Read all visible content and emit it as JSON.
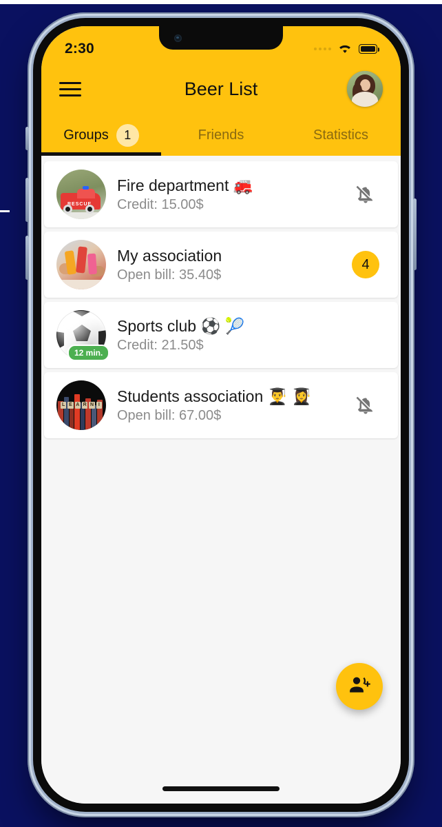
{
  "theme": {
    "accent": "#ffc20e",
    "badge_soft": "#ffe7a6",
    "page_bg": "#0a1160",
    "list_bg": "#f6f6f6",
    "card_bg": "#ffffff",
    "muted_text": "#8b8b8b",
    "green_badge": "#4caf50"
  },
  "status_bar": {
    "time": "2:30",
    "signal_icon": "signal-dots-icon",
    "wifi_icon": "wifi-icon",
    "battery_icon": "battery-full-icon"
  },
  "app_bar": {
    "menu_icon": "hamburger-menu-icon",
    "title": "Beer List",
    "avatar_icon": "user-avatar-photo"
  },
  "tabs": [
    {
      "label": "Groups",
      "badge": "1",
      "active": true
    },
    {
      "label": "Friends",
      "badge": "",
      "active": false
    },
    {
      "label": "Statistics",
      "badge": "",
      "active": false
    }
  ],
  "groups": [
    {
      "title": "Fire department 🚒",
      "subtitle": "Credit: 15.00$",
      "right_icon": "bell-off-icon",
      "right_badge": "",
      "thumb_badge": "",
      "thumb_icon": "fire-truck-thumbnail"
    },
    {
      "title": "My association",
      "subtitle": "Open bill: 35.40$",
      "right_icon": "",
      "right_badge": "4",
      "thumb_badge": "",
      "thumb_icon": "cheers-drinks-thumbnail"
    },
    {
      "title": "Sports club ⚽ 🎾",
      "subtitle": "Credit: 21.50$",
      "right_icon": "",
      "right_badge": "",
      "thumb_badge": "12 min.",
      "thumb_icon": "soccer-ball-thumbnail"
    },
    {
      "title": "Students association 👨‍🎓 👩‍🎓",
      "subtitle": "Open bill: 67.00$",
      "right_icon": "bell-off-icon",
      "right_badge": "",
      "thumb_badge": "",
      "thumb_icon": "books-learning-thumbnail"
    }
  ],
  "fab": {
    "icon": "person-add-icon",
    "label": ""
  },
  "home_indicator": "home-indicator-bar"
}
